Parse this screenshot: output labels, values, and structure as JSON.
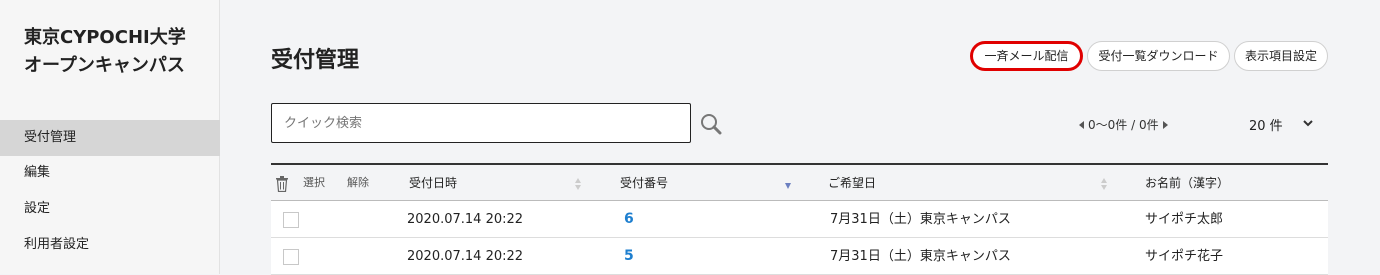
{
  "sidebar": {
    "brand_line1": "東京CYPOCHI大学",
    "brand_line2": "オープンキャンパス",
    "items": [
      {
        "label": "受付管理"
      },
      {
        "label": "編集"
      },
      {
        "label": "設定"
      },
      {
        "label": "利用者設定"
      }
    ]
  },
  "header": {
    "title": "受付管理",
    "buttons": {
      "bulk_mail": "一斉メール配信",
      "download": "受付一覧ダウンロード",
      "display_settings": "表示項目設定"
    }
  },
  "search": {
    "placeholder": "クイック検索"
  },
  "pager": {
    "text": "0〜0件 / 0件"
  },
  "per_page": {
    "value": "20 件"
  },
  "table": {
    "columns": {
      "select": "選択",
      "deselect": "解除",
      "received_at": "受付日時",
      "number": "受付番号",
      "desired_date": "ご希望日",
      "name": "お名前（漢字）"
    },
    "rows": [
      {
        "received_at": "2020.07.14 20:22",
        "number": "6",
        "desired_date": "7月31日（土）東京キャンパス",
        "name": "サイポチ太郎"
      },
      {
        "received_at": "2020.07.14 20:22",
        "number": "5",
        "desired_date": "7月31日（土）東京キャンパス",
        "name": "サイポチ花子"
      }
    ]
  },
  "colors": {
    "accent": "#1e7fcf",
    "highlight": "#e00000",
    "active_nav": "#d6d6d6"
  }
}
